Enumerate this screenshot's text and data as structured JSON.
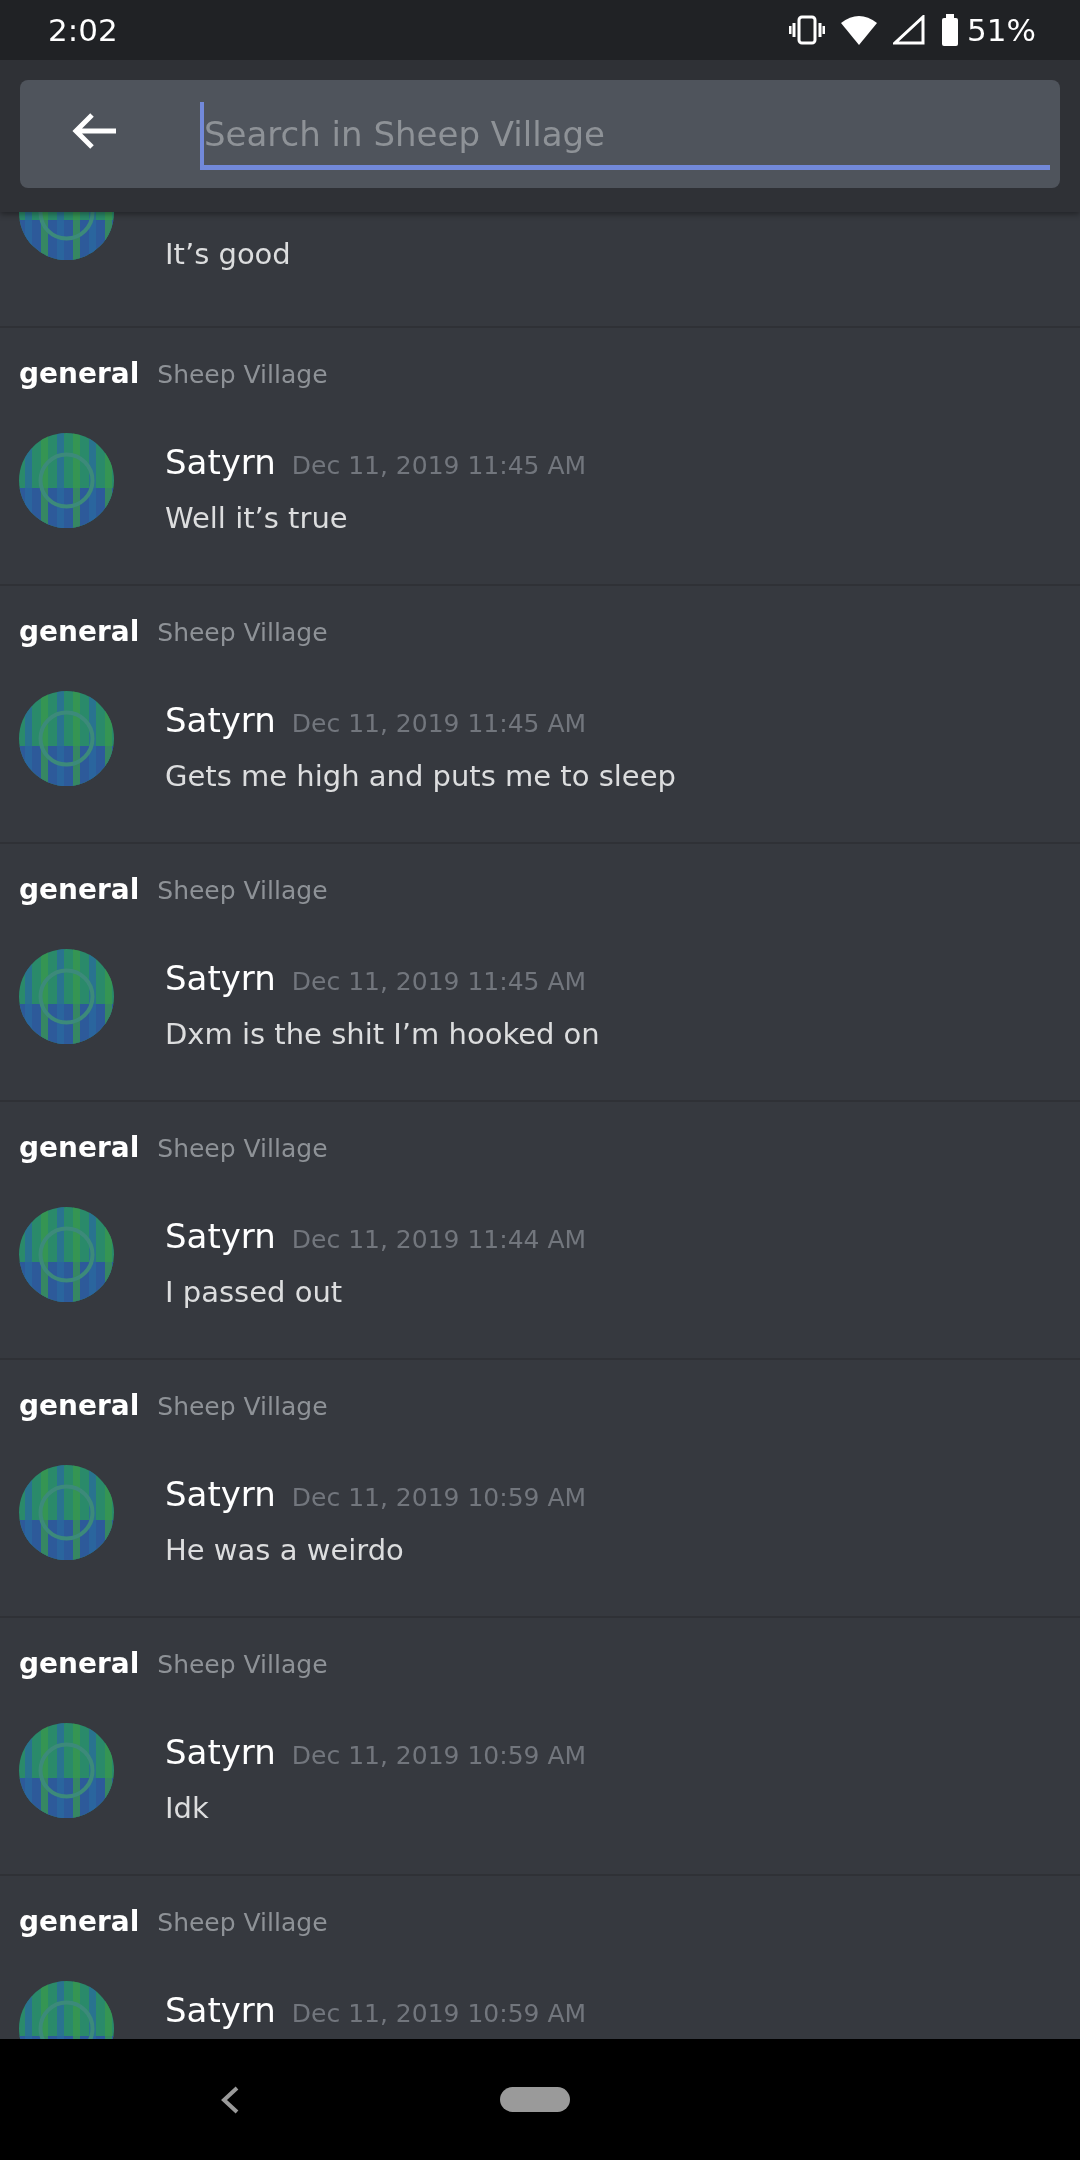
{
  "status_bar": {
    "time": "2:02",
    "battery": "51%"
  },
  "search": {
    "placeholder": "Search in Sheep Village"
  },
  "partial_result": {
    "text": "It’s good"
  },
  "results": [
    {
      "channel": "general",
      "server": "Sheep Village",
      "author": "Satyrn",
      "timestamp": "Dec 11, 2019 11:45 AM",
      "text": "Well it’s true"
    },
    {
      "channel": "general",
      "server": "Sheep Village",
      "author": "Satyrn",
      "timestamp": "Dec 11, 2019 11:45 AM",
      "text": "Gets me high and puts me to sleep"
    },
    {
      "channel": "general",
      "server": "Sheep Village",
      "author": "Satyrn",
      "timestamp": "Dec 11, 2019 11:45 AM",
      "text": "Dxm is the shit I’m hooked on"
    },
    {
      "channel": "general",
      "server": "Sheep Village",
      "author": "Satyrn",
      "timestamp": "Dec 11, 2019 11:44 AM",
      "text": "I passed out"
    },
    {
      "channel": "general",
      "server": "Sheep Village",
      "author": "Satyrn",
      "timestamp": "Dec 11, 2019 10:59 AM",
      "text": "He was a weirdo"
    },
    {
      "channel": "general",
      "server": "Sheep Village",
      "author": "Satyrn",
      "timestamp": "Dec 11, 2019 10:59 AM",
      "text": "Idk"
    },
    {
      "channel": "general",
      "server": "Sheep Village",
      "author": "Satyrn",
      "timestamp": "Dec 11, 2019 10:59 AM"
    }
  ]
}
